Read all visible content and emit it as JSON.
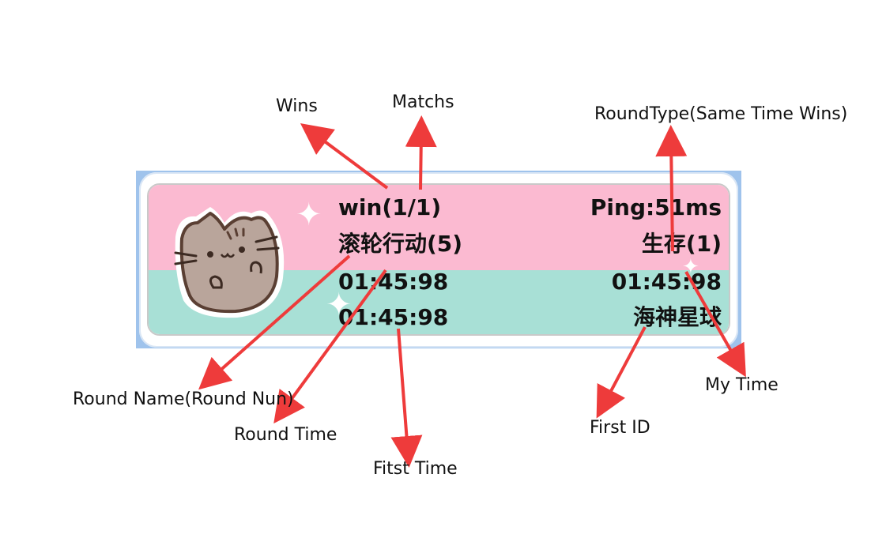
{
  "hud": {
    "wins": "win(1/1)",
    "ping": "Ping:51ms",
    "round_name": "滚轮行动(5)",
    "round_type": "生存(1)",
    "round_time": "01:45:98",
    "my_time": "01:45:98",
    "first_time": "01:45:98",
    "first_id": "海神星球",
    "colors": {
      "top_band": "#fbbad1",
      "bottom_band": "#a8e0d6",
      "frame": "#9fc3ec"
    },
    "avatar_icon": "pusheen-cat-icon"
  },
  "annotations": {
    "wins": "Wins",
    "matchs": "Matchs",
    "round_type": "RoundType(Same Time Wins)",
    "round_name": "Round Name(Round Nun)",
    "round_time": "Round Time",
    "first_time": "Fitst Time",
    "first_id": "First ID",
    "my_time": "My Time",
    "arrow_color": "#ee3b3b"
  }
}
